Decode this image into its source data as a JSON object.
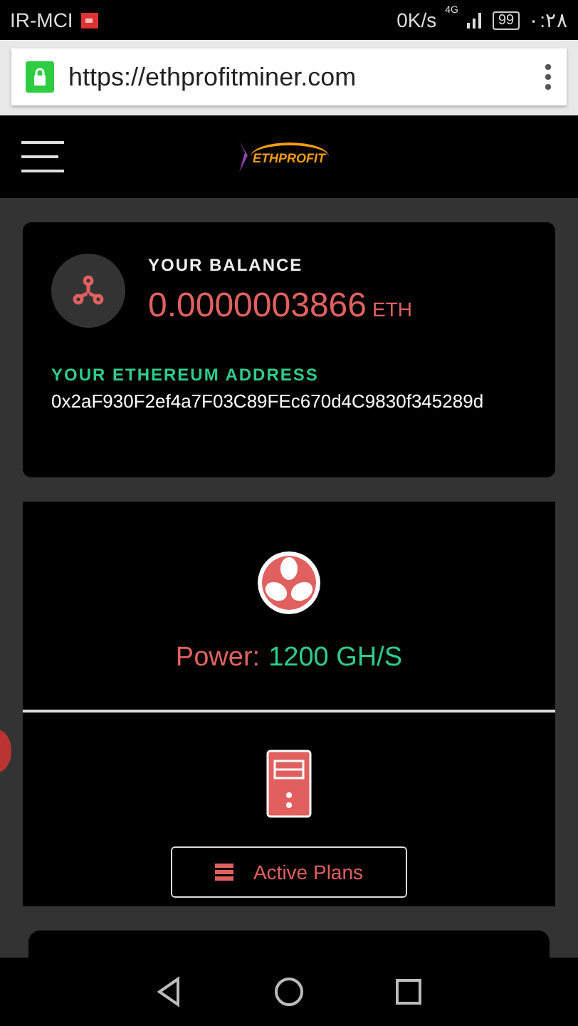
{
  "status_bar": {
    "carrier": "IR-MCI",
    "speed": "0K/s",
    "network": "4G",
    "battery": "99",
    "time": "۰:۲۸"
  },
  "browser": {
    "url": "https://ethprofitminer.com",
    "secure": true
  },
  "header": {
    "logo_text": "ETHPROFIT"
  },
  "balance_card": {
    "label": "YOUR BALANCE",
    "amount": "0.0000003866",
    "unit": "ETH",
    "address_label": "YOUR ETHEREUM ADDRESS",
    "address": "0x2aF930F2ef4a7F03C89FEc670d4C9830f345289d"
  },
  "power_card": {
    "label": "Power:",
    "value": "1200 GH/S",
    "button": "Active Plans"
  }
}
